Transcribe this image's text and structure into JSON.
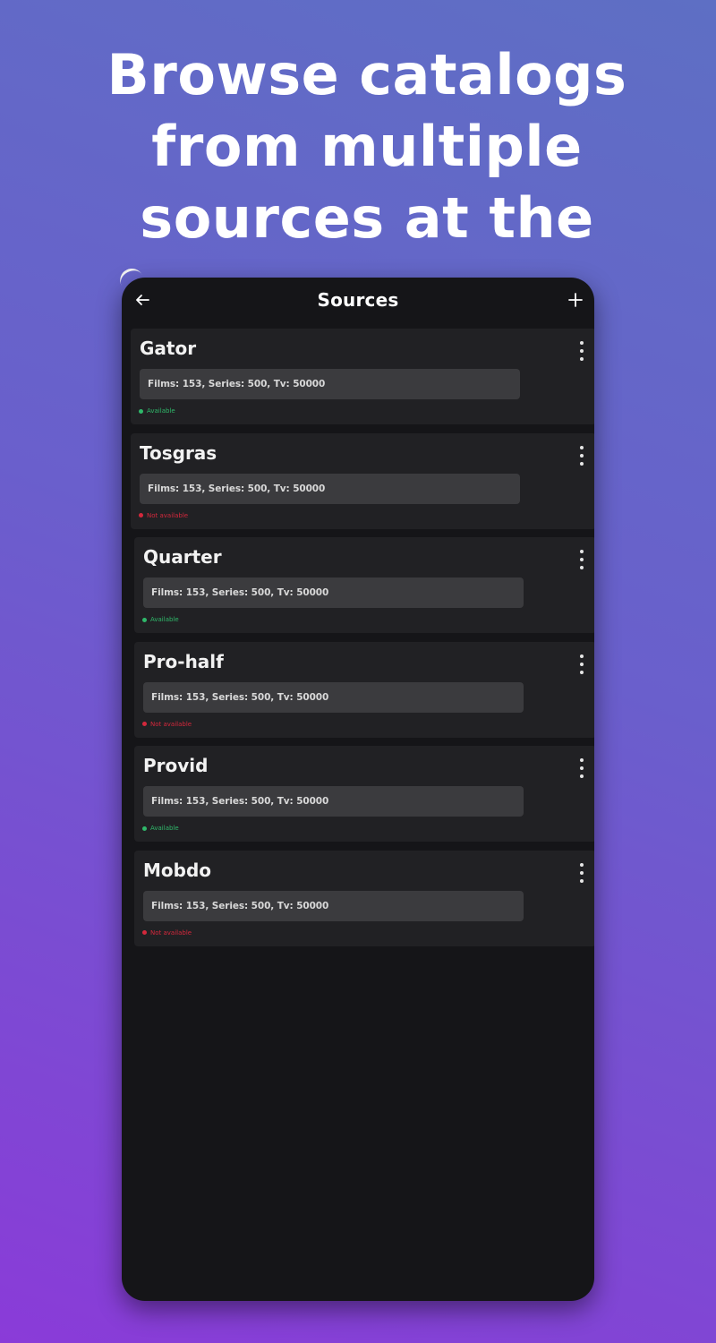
{
  "headline": {
    "line1": "Browse catalogs",
    "line2": "from multiple",
    "line3": "sources at the"
  },
  "appbar": {
    "title": "Sources",
    "back_icon": "arrow-left-icon",
    "add_icon": "plus-icon"
  },
  "colors": {
    "available": "#2fb86a",
    "not_available": "#d4283c",
    "card_bg": "#212124",
    "screen_bg": "#151518"
  },
  "sources": [
    {
      "name": "Gator",
      "stats": "Films: 153, Series: 500, Tv: 50000",
      "status": "Available",
      "available": true
    },
    {
      "name": "Tosgras",
      "stats": "Films: 153, Series: 500, Tv: 50000",
      "status": "Not available",
      "available": false
    },
    {
      "name": "Quarter",
      "stats": "Films: 153, Series: 500, Tv: 50000",
      "status": "Available",
      "available": true
    },
    {
      "name": "Pro-half",
      "stats": "Films: 153, Series: 500, Tv: 50000",
      "status": "Not available",
      "available": false
    },
    {
      "name": "Provid",
      "stats": "Films: 153, Series: 500, Tv: 50000",
      "status": "Available",
      "available": true
    },
    {
      "name": "Mobdo",
      "stats": "Films: 153, Series: 500, Tv: 50000",
      "status": "Not available",
      "available": false
    }
  ]
}
